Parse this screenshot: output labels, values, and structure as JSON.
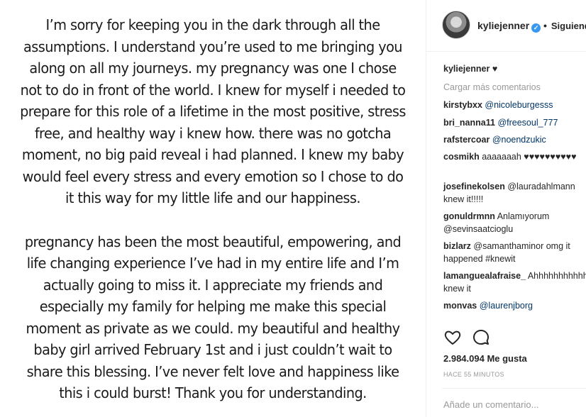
{
  "post": {
    "paragraphs": [
      "I’m sorry for keeping you in the dark through all the assumptions. I understand you’re used to me bringing you along on all my journeys. my pregnancy was one I chose not to do in front of the world. I knew for myself i needed to prepare for this role of a lifetime in the most positive, stress free, and healthy way i knew how. there was no gotcha moment, no big paid reveal i had planned. I knew my baby would feel every stress and every emotion so I chose to do it this way for my little life and our happiness.",
      "pregnancy has been the most beautiful, empowering, and life changing experience I’ve had in my entire life and I’m actually going to miss it. I appreciate my friends and especially my family for helping me make this special moment as private as we could. my beautiful and healthy baby girl arrived February 1st and i just couldn’t wait to share this blessing. I’ve never felt love and happiness like this i could burst! Thank you for understanding."
    ]
  },
  "header": {
    "username": "kyliejenner",
    "verified_glyph": "✓",
    "separator": "•",
    "follow_label": "Siguiendo"
  },
  "caption": {
    "user": "kyliejenner",
    "text": "♥"
  },
  "load_more_label": "Cargar más comentarios",
  "comments": [
    {
      "user": "kirstybxx",
      "text": "@nicoleburgesss"
    },
    {
      "user": "bri_nanna11",
      "text": "@freesoul_777"
    },
    {
      "user": "rafstercoar",
      "text": "@noendzukic"
    },
    {
      "user": "cosmikh",
      "text": "aaaaaaah ♥♥♥♥♥♥♥♥♥♥"
    },
    {
      "user": "josefinekolsen",
      "text": "@lauradahlmann knew it!!!!!"
    },
    {
      "user": "gonuldrmnn",
      "text": "Anlamıyorum @sevinsaatcioglu"
    },
    {
      "user": "bizlarz",
      "text": "@samanthaminor omg it happened #knewit"
    },
    {
      "user": "lamanguealafraise_",
      "text": "Ahhhhhhhhhhh knew it"
    },
    {
      "user": "monvas",
      "text": "@laurenjborg"
    }
  ],
  "likes_label": "2.984.094 Me gusta",
  "time_label": "HACE 55 MINUTOS",
  "add_comment_placeholder": "Añade un comentario...",
  "icons": [
    "heart-icon",
    "comment-icon",
    "verified-badge-icon"
  ],
  "colors": {
    "mention": "#003569",
    "muted": "#999999",
    "verified": "#3897f0"
  }
}
